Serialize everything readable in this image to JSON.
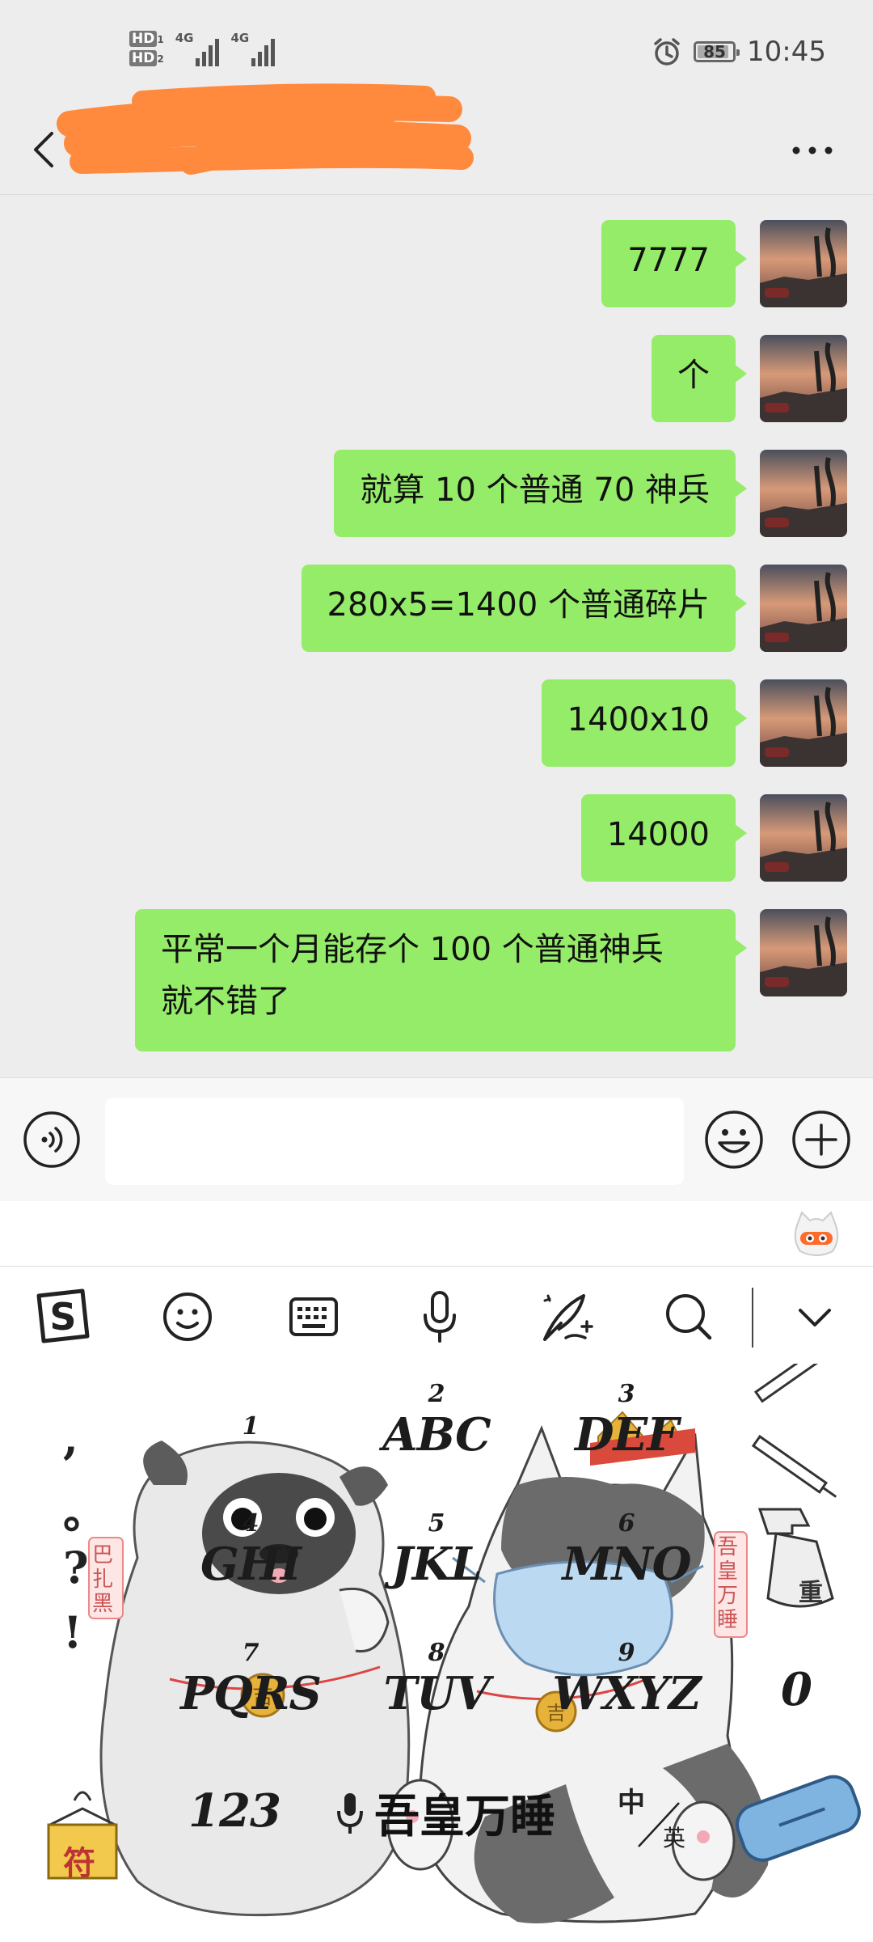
{
  "status_bar": {
    "hd1": "HD",
    "hd1_sub": "1",
    "hd2": "HD",
    "hd2_sub": "2",
    "net1": "4G",
    "net2": "4G",
    "battery": "85",
    "time": "10:45"
  },
  "header": {
    "title_redacted": true
  },
  "messages": [
    {
      "text": "7777"
    },
    {
      "text": "个"
    },
    {
      "text": "就算 10 个普通 70 神兵"
    },
    {
      "text": "280x5=1400 个普通碎片"
    },
    {
      "text": "1400x10"
    },
    {
      "text": "14000"
    },
    {
      "text": "平常一个月能存个 100 个普通神兵\n就不错了"
    }
  ],
  "input": {
    "placeholder": ""
  },
  "keyboard": {
    "toolbar_icons": [
      "sogou-logo-icon",
      "emoji-icon",
      "keyboard-icon",
      "microphone-icon",
      "quill-pen-icon",
      "search-icon",
      "chevron-down-icon"
    ],
    "punctuation": [
      ",",
      "。",
      "?",
      "!"
    ],
    "keys": [
      {
        "num": "1",
        "letters": ""
      },
      {
        "num": "2",
        "letters": "ABC"
      },
      {
        "num": "3",
        "letters": "DEF"
      },
      {
        "num": "4",
        "letters": "GHI"
      },
      {
        "num": "5",
        "letters": "JKL"
      },
      {
        "num": "6",
        "letters": "MNO"
      },
      {
        "num": "7",
        "letters": "PQRS"
      },
      {
        "num": "8",
        "letters": "TUV"
      },
      {
        "num": "9",
        "letters": "WXYZ"
      }
    ],
    "zero": "0",
    "symbols_key": "123",
    "space_label": "吾皇万睡",
    "lang_zh": "中",
    "lang_en": "英",
    "talisman": "符",
    "stamp_left": "巴扎黑",
    "stamp_right": "吾皇万睡",
    "spray_label": "重"
  },
  "colors": {
    "bubble": "#95ec69",
    "background": "#ededed",
    "redaction": "#ff8a3d"
  }
}
